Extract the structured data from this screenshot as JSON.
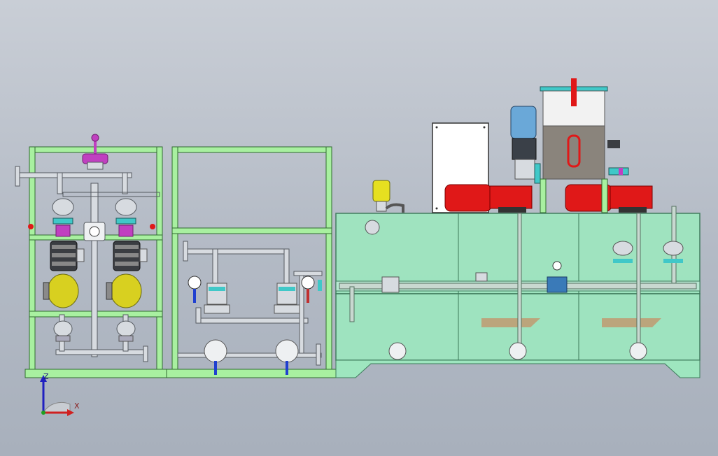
{
  "viewport": {
    "background_top": "#c9ced6",
    "background_bottom": "#a8b0bc"
  },
  "colors": {
    "frame": "#a8f0a0",
    "frame_edge": "#2f6a2f",
    "tank": "#9ee6bf",
    "tank_edge": "#3c7a5a",
    "pipe": "#d7dbe0",
    "pipe_edge": "#555a60",
    "motor_red": "#e01818",
    "motor_blue": "#6aa8d8",
    "yellow_valve": "#d8d020",
    "magenta": "#c040c0",
    "cyan_flange": "#40c8c8",
    "control_box": "#ffffff",
    "brown_baffle": "#c09a70"
  },
  "triad": {
    "z_label": "Z",
    "x_label": "X",
    "z_color": "#2020c0",
    "x_color": "#d02020",
    "y_color": "#20a020"
  }
}
